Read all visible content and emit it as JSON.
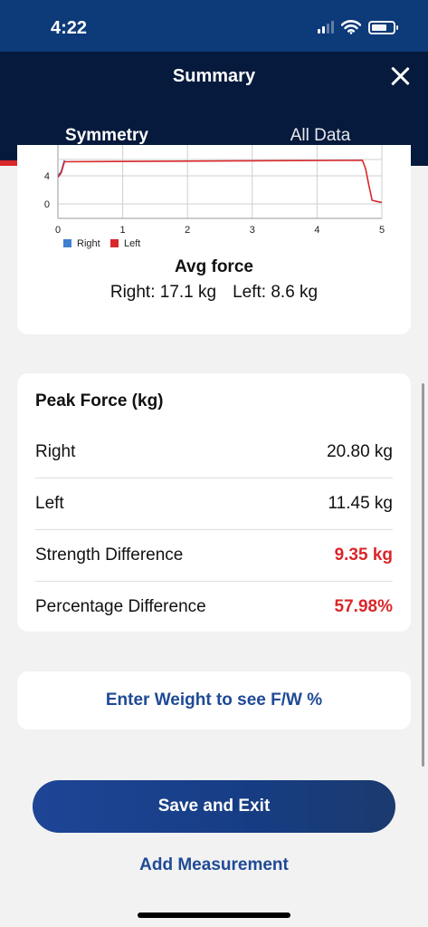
{
  "status_bar": {
    "time": "4:22",
    "icons": [
      "signal-icon",
      "wifi-icon",
      "battery-icon"
    ]
  },
  "nav": {
    "title": "Summary",
    "close_icon": "close-icon",
    "tabs": [
      {
        "label": "Symmetry",
        "active": true
      },
      {
        "label": "All Data",
        "active": false
      }
    ]
  },
  "chart_data": {
    "type": "line",
    "x_ticks": [
      "0",
      "1",
      "2",
      "3",
      "4",
      "5"
    ],
    "y_ticks": [
      "0",
      "4"
    ],
    "xlim": [
      0,
      5
    ],
    "grid": true,
    "legend_position": "bottom-left",
    "series": [
      {
        "name": "Right",
        "color": "#3f7fd1",
        "points": [
          [
            0.0,
            4.0
          ],
          [
            0.05,
            4.6
          ],
          [
            0.1,
            6.2
          ]
        ]
      },
      {
        "name": "Left",
        "color": "#d9272a",
        "points": [
          [
            0.0,
            3.8
          ],
          [
            0.05,
            4.4
          ],
          [
            0.1,
            6.0
          ],
          [
            4.7,
            6.2
          ],
          [
            4.75,
            5.0
          ],
          [
            4.8,
            2.6
          ],
          [
            4.85,
            0.5
          ],
          [
            4.95,
            0.3
          ],
          [
            5.0,
            0.2
          ]
        ]
      }
    ]
  },
  "avg_force": {
    "title": "Avg force",
    "right": "Right: 17.1 kg",
    "left": "Left: 8.6 kg"
  },
  "peak_force": {
    "title": "Peak Force (kg)",
    "rows": [
      {
        "label": "Right",
        "value": "20.80 kg",
        "highlight": false
      },
      {
        "label": "Left",
        "value": "11.45 kg",
        "highlight": false
      },
      {
        "label": "Strength Difference",
        "value": "9.35 kg",
        "highlight": true
      },
      {
        "label": "Percentage Difference",
        "value": "57.98%",
        "highlight": true
      }
    ]
  },
  "weight_prompt": "Enter Weight to see F/W %",
  "actions": {
    "save": "Save and Exit",
    "add": "Add Measurement"
  },
  "colors": {
    "navy": "#051a3c",
    "status_blue": "#0d3a78",
    "accent_red": "#d9272a",
    "link_blue": "#1f4a96"
  }
}
